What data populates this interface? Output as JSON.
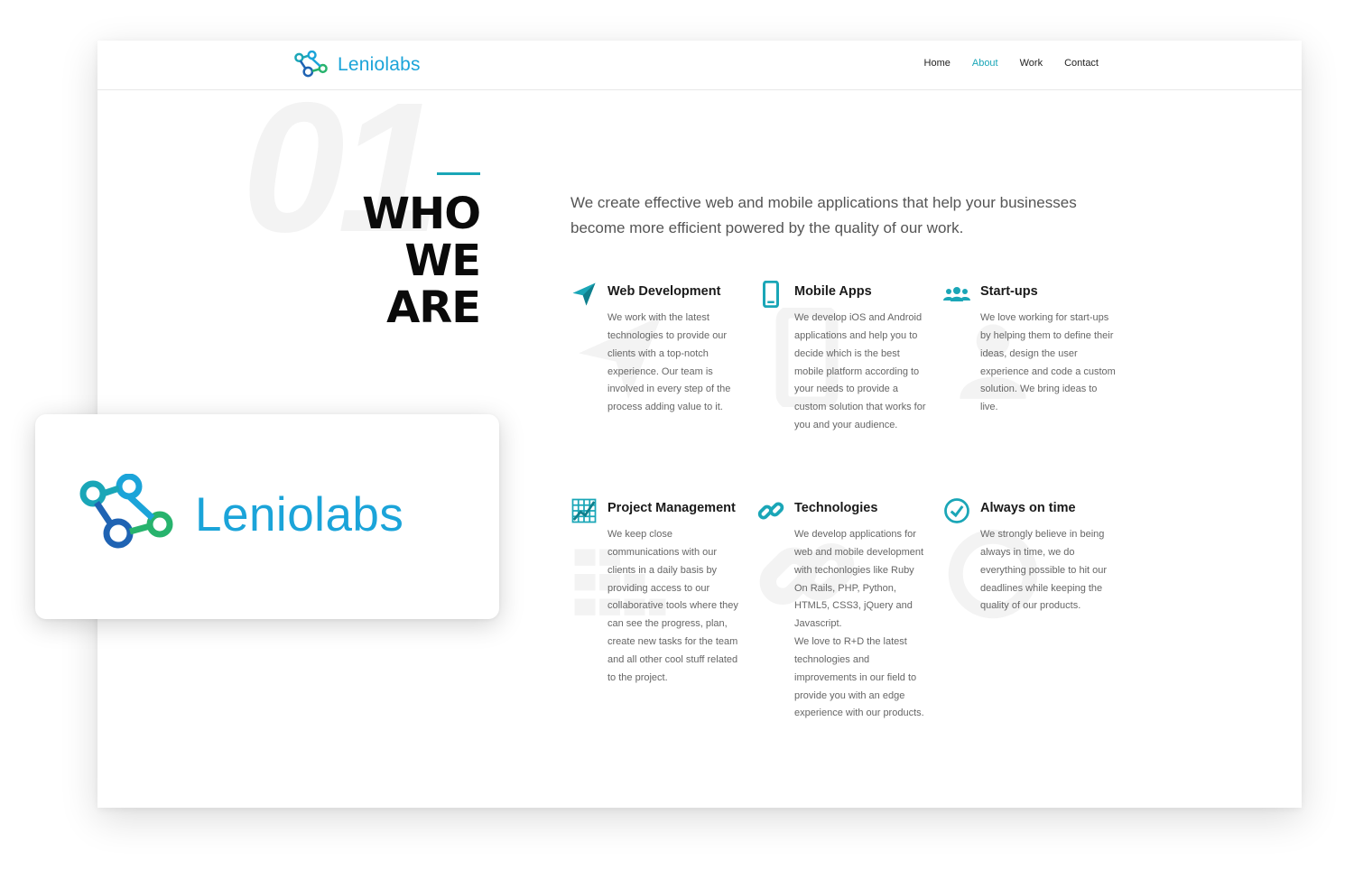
{
  "brand": {
    "name": "Leniolabs",
    "logo_icon": "molecule-logo-icon",
    "color_primary": "#1ba4d9",
    "color_accent": "#1aa6b7"
  },
  "nav": {
    "items": [
      {
        "label": "Home",
        "active": false
      },
      {
        "label": "About",
        "active": true
      },
      {
        "label": "Work",
        "active": false
      },
      {
        "label": "Contact",
        "active": false
      }
    ]
  },
  "hero": {
    "number": "01",
    "heading": [
      "WHO",
      "WE",
      "ARE"
    ],
    "intro": "We create effective web and mobile applications that help your businesses become more efficient powered by the quality of our work."
  },
  "services": [
    {
      "icon": "paper-plane-icon",
      "title": "Web Development",
      "text": "We work with the latest technologies to provide our clients with a top-notch experience. Our team is involved in every step of the process adding value to it."
    },
    {
      "icon": "mobile-phone-icon",
      "title": "Mobile Apps",
      "text": "We develop iOS and Android applications and help you to decide which is the best mobile platform according to your needs to provide a custom solution that works for you and your audience."
    },
    {
      "icon": "users-icon",
      "title": "Start-ups",
      "text": "We love working for start-ups by helping them to define their ideas, design the user experience and code a custom solution. We bring ideas to live."
    },
    {
      "icon": "grid-chart-icon",
      "title": "Project Management",
      "text": "We keep close communications with our clients in a daily basis by providing access to our collaborative tools where they can see the progress, plan, create new tasks for the team and all other cool stuff related to the project."
    },
    {
      "icon": "link-icon",
      "title": "Technologies",
      "text": "We develop applications for web and mobile development with techonlogies like Ruby On Rails, PHP, Python, HTML5, CSS3, jQuery and Javascript.\nWe love to R+D the latest technologies and improvements in our field to provide you with an edge experience with our products."
    },
    {
      "icon": "clock-check-icon",
      "title": "Always on time",
      "text": "We strongly believe in being always in time, we do everything possible to hit our deadlines while keeping the quality of our products."
    }
  ]
}
